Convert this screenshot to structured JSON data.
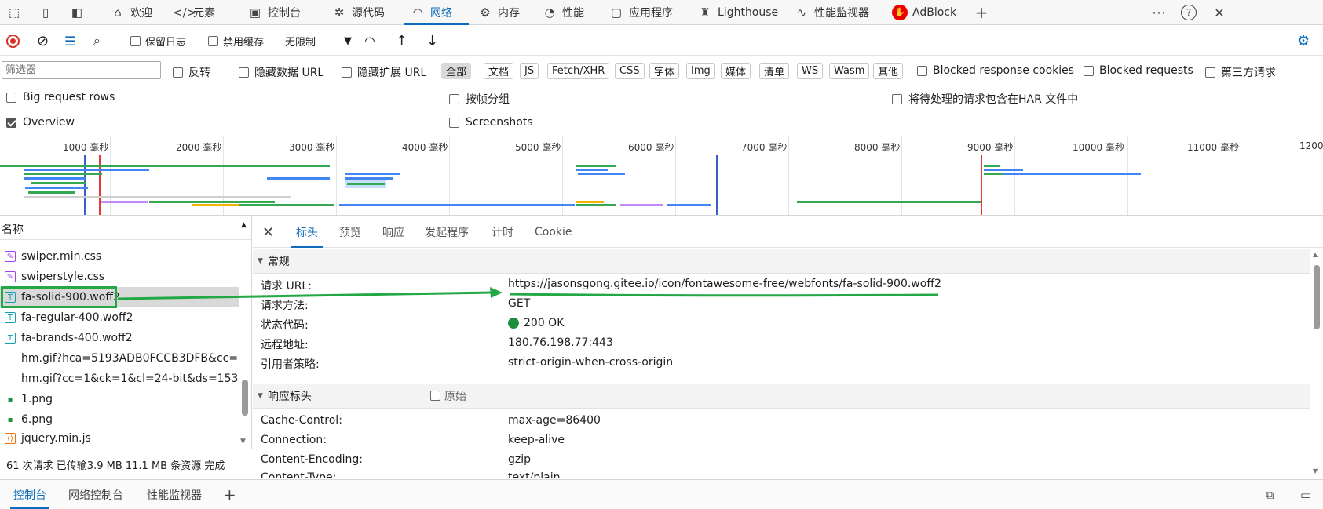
{
  "top_tabs": [
    {
      "label": "欢迎",
      "icon": "home-icon"
    },
    {
      "label": "元素",
      "icon": "code-icon"
    },
    {
      "label": "控制台",
      "icon": "console-icon"
    },
    {
      "label": "源代码",
      "icon": "bug-icon"
    },
    {
      "label": "网络",
      "icon": "wifi-icon"
    },
    {
      "label": "内存",
      "icon": "chip-icon"
    },
    {
      "label": "性能",
      "icon": "gauge-icon"
    },
    {
      "label": "应用程序",
      "icon": "window-icon"
    },
    {
      "label": "Lighthouse",
      "icon": "lighthouse-icon"
    },
    {
      "label": "性能监视器",
      "icon": "pulse-icon"
    },
    {
      "label": "AdBlock",
      "icon": "adblock-icon"
    }
  ],
  "toolbar": {
    "preserve_log": "保留日志",
    "disable_cache": "禁用缓存",
    "throttle": "无限制"
  },
  "filter": {
    "placeholder": "筛选器",
    "invert": "反转",
    "hide_data_url": "隐藏数据 URL",
    "hide_ext_url": "隐藏扩展 URL",
    "chips": [
      "全部",
      "文档",
      "JS",
      "Fetch/XHR",
      "CSS",
      "字体",
      "Img",
      "媒体",
      "清单",
      "WS",
      "Wasm",
      "其他"
    ],
    "blocked_cookies": "Blocked response cookies",
    "blocked_requests": "Blocked requests",
    "third_party": "第三方请求"
  },
  "options": {
    "big_rows": "Big request rows",
    "group_frame": "按帧分组",
    "include_pending_har": "将待处理的请求包含在HAR 文件中",
    "overview": "Overview",
    "screenshots": "Screenshots"
  },
  "timeline_labels": [
    "1000 毫秒",
    "2000 毫秒",
    "3000 毫秒",
    "4000 毫秒",
    "5000 毫秒",
    "6000 毫秒",
    "7000 毫秒",
    "8000 毫秒",
    "9000 毫秒",
    "10000 毫秒",
    "11000 毫秒",
    "1200"
  ],
  "requests": {
    "header": "名称",
    "items": [
      {
        "name": "swiper.min.css",
        "type": "css"
      },
      {
        "name": "swiperstyle.css",
        "type": "css"
      },
      {
        "name": "fa-solid-900.woff2",
        "type": "font"
      },
      {
        "name": "fa-regular-400.woff2",
        "type": "font"
      },
      {
        "name": "fa-brands-400.woff2",
        "type": "font"
      },
      {
        "name": "hm.gif?hca=5193ADB0FCCB3DFB&cc=...",
        "type": "none"
      },
      {
        "name": "hm.gif?cc=1&ck=1&cl=24-bit&ds=153...",
        "type": "none"
      },
      {
        "name": "1.png",
        "type": "img"
      },
      {
        "name": "6.png",
        "type": "img"
      },
      {
        "name": "jquery.min.js",
        "type": "js"
      }
    ],
    "status": "61 次请求  已传输3.9 MB  11.1 MB 条资源  完成"
  },
  "detail": {
    "tabs": [
      "标头",
      "预览",
      "响应",
      "发起程序",
      "计时",
      "Cookie"
    ],
    "general_title": "常规",
    "general": [
      {
        "key": "请求 URL:",
        "value": "https://jasonsgong.gitee.io/icon/fontawesome-free/webfonts/fa-solid-900.woff2"
      },
      {
        "key": "请求方法:",
        "value": "GET"
      },
      {
        "key": "状态代码:",
        "value": "200 OK"
      },
      {
        "key": "远程地址:",
        "value": "180.76.198.77:443"
      },
      {
        "key": "引用者策略:",
        "value": "strict-origin-when-cross-origin"
      }
    ],
    "response_title": "响应标头",
    "raw": "原始",
    "response": [
      {
        "key": "Cache-Control:",
        "value": "max-age=86400"
      },
      {
        "key": "Connection:",
        "value": "keep-alive"
      },
      {
        "key": "Content-Encoding:",
        "value": "gzip"
      },
      {
        "key": "Content-Type:",
        "value": "text/plain"
      }
    ]
  },
  "drawer": {
    "tabs": [
      "控制台",
      "网络控制台",
      "性能监视器"
    ]
  },
  "colors": {
    "accent": "#0f6cbd",
    "annotation": "#22a844",
    "status_ok": "#1e8e3e"
  }
}
